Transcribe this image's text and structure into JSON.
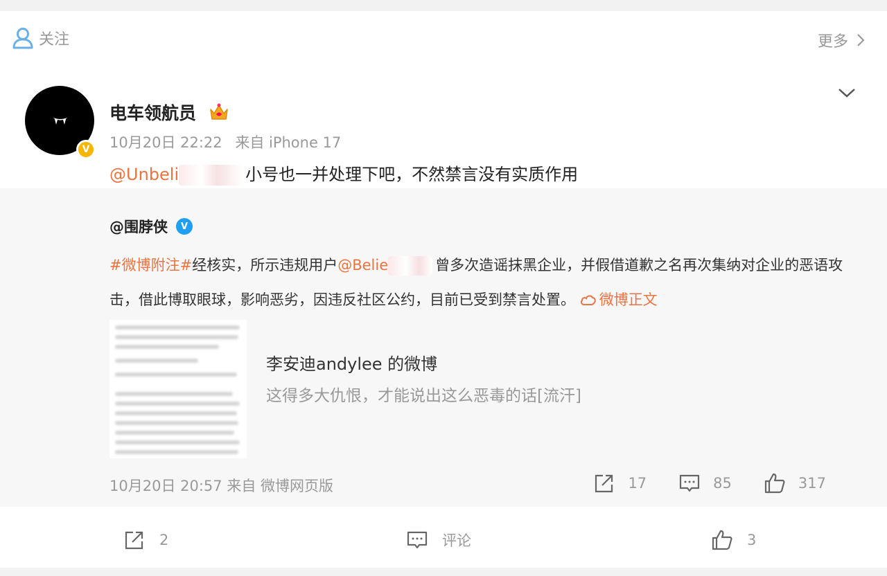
{
  "header": {
    "follow_label": "关注",
    "more_label": "更多"
  },
  "post": {
    "author": "电车领航员",
    "time": "10月20日 22:22",
    "source": "来自 iPhone 17",
    "mention": "@Unbeli",
    "text": "小号也一并处理下吧，不然禁言没有实质作用"
  },
  "repost": {
    "author": "@围脖侠",
    "topic": "#微博附注#",
    "text_a": "经核实，所示违规用户",
    "mention": "@Belie",
    "text_b": "曾多次造谣抹黑企业，并假借道歉之名再次集纳对企业的恶语攻击，借此博取眼球，影响恶劣，因违反社区公约，目前已受到禁言处置。",
    "fulltext_label": "微博正文",
    "embed_title": "李安迪andylee 的微博",
    "embed_desc": "这得多大仇恨，才能说出这么恶毒的话[流汗]",
    "time": "10月20日 20:57",
    "source": "来自 微博网页版",
    "repost_count": "17",
    "comment_count": "85",
    "like_count": "317"
  },
  "actions": {
    "repost_count": "2",
    "comment_label": "评论",
    "like_count": "3"
  },
  "colors": {
    "accent": "#eb7340",
    "verified_blue": "#1e9ff2",
    "verified_gold": "#f7b500"
  },
  "icons": [
    "user-icon",
    "chevron-right-icon",
    "chevron-down-icon",
    "crown-icon",
    "cloud-icon",
    "share-icon",
    "comment-icon",
    "like-icon"
  ]
}
